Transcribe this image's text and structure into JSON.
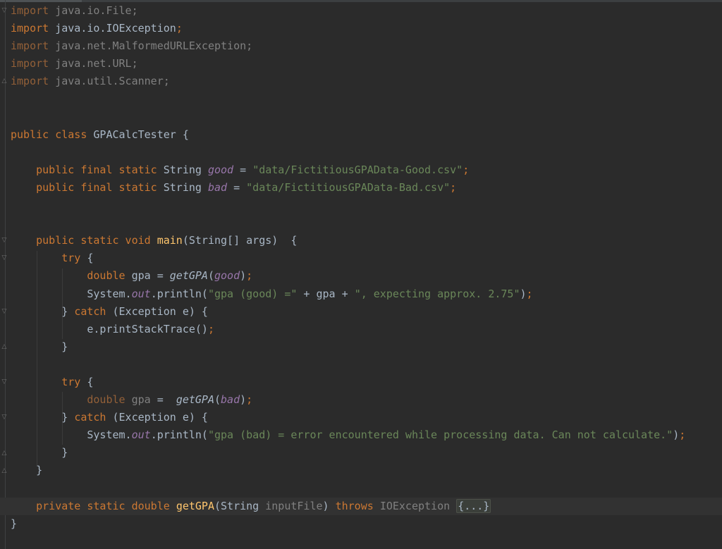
{
  "lines": [
    {
      "segs": [
        [
          "kw dim-kw",
          "import"
        ],
        [
          "dim",
          " java.io.File;"
        ]
      ]
    },
    {
      "segs": [
        [
          "kw",
          "import"
        ],
        [
          "",
          " java.io.IOException"
        ],
        [
          "kw",
          ";"
        ]
      ]
    },
    {
      "segs": [
        [
          "kw dim-kw",
          "import"
        ],
        [
          "dim",
          " java.net.MalformedURLException;"
        ]
      ]
    },
    {
      "segs": [
        [
          "kw dim-kw",
          "import"
        ],
        [
          "dim",
          " java.net.URL;"
        ]
      ]
    },
    {
      "segs": [
        [
          "kw dim-kw",
          "import"
        ],
        [
          "dim",
          " java.util.Scanner;"
        ]
      ]
    },
    {
      "segs": []
    },
    {
      "segs": []
    },
    {
      "segs": [
        [
          "kw",
          "public class "
        ],
        [
          "",
          "GPACalcTester {"
        ]
      ]
    },
    {
      "segs": []
    },
    {
      "segs": [
        [
          "",
          "    "
        ],
        [
          "kw",
          "public final static "
        ],
        [
          "",
          "String "
        ],
        [
          "fld",
          "good"
        ],
        [
          "",
          " = "
        ],
        [
          "str",
          "\"data/FictitiousGPAData-Good.csv\""
        ],
        [
          "kw",
          ";"
        ]
      ]
    },
    {
      "segs": [
        [
          "",
          "    "
        ],
        [
          "kw",
          "public final static "
        ],
        [
          "",
          "String "
        ],
        [
          "fld",
          "bad"
        ],
        [
          "",
          " = "
        ],
        [
          "str",
          "\"data/FictitiousGPAData-Bad.csv\""
        ],
        [
          "kw",
          ";"
        ]
      ]
    },
    {
      "segs": []
    },
    {
      "segs": []
    },
    {
      "segs": [
        [
          "",
          "    "
        ],
        [
          "kw",
          "public static void "
        ],
        [
          "meth",
          "main"
        ],
        [
          "",
          "(String[] args)  {"
        ]
      ]
    },
    {
      "segs": [
        [
          "",
          "        "
        ],
        [
          "kw",
          "try "
        ],
        [
          "",
          "{"
        ]
      ]
    },
    {
      "segs": [
        [
          "",
          "            "
        ],
        [
          "kw",
          "double "
        ],
        [
          "",
          "gpa = "
        ],
        [
          "itm",
          "getGPA"
        ],
        [
          "",
          "("
        ],
        [
          "fld",
          "good"
        ],
        [
          "",
          ")"
        ],
        [
          "kw",
          ";"
        ]
      ]
    },
    {
      "segs": [
        [
          "",
          "            System."
        ],
        [
          "fld",
          "out"
        ],
        [
          "",
          ".println("
        ],
        [
          "str",
          "\"gpa (good) =\""
        ],
        [
          "",
          " + gpa + "
        ],
        [
          "str",
          "\", expecting approx. 2.75\""
        ],
        [
          "",
          ")"
        ],
        [
          "kw",
          ";"
        ]
      ]
    },
    {
      "segs": [
        [
          "",
          "        } "
        ],
        [
          "kw",
          "catch "
        ],
        [
          "",
          "(Exception e) {"
        ]
      ]
    },
    {
      "segs": [
        [
          "",
          "            e.printStackTrace()"
        ],
        [
          "kw",
          ";"
        ]
      ]
    },
    {
      "segs": [
        [
          "",
          "        }"
        ]
      ]
    },
    {
      "segs": []
    },
    {
      "segs": [
        [
          "",
          "        "
        ],
        [
          "kw",
          "try "
        ],
        [
          "",
          "{"
        ]
      ]
    },
    {
      "segs": [
        [
          "",
          "            "
        ],
        [
          "kw dim-kw",
          "double "
        ],
        [
          "dim",
          "gpa"
        ],
        [
          "",
          " =  "
        ],
        [
          "itm",
          "getGPA"
        ],
        [
          "",
          "("
        ],
        [
          "fld",
          "bad"
        ],
        [
          "",
          ")"
        ],
        [
          "kw",
          ";"
        ]
      ]
    },
    {
      "segs": [
        [
          "",
          "        } "
        ],
        [
          "kw",
          "catch "
        ],
        [
          "",
          "(Exception e) {"
        ]
      ]
    },
    {
      "segs": [
        [
          "",
          "            System."
        ],
        [
          "fld",
          "out"
        ],
        [
          "",
          ".println("
        ],
        [
          "str",
          "\"gpa (bad) = error encountered while processing data. Can not calculate.\""
        ],
        [
          "",
          ")"
        ],
        [
          "kw",
          ";"
        ]
      ]
    },
    {
      "segs": [
        [
          "",
          "        }"
        ]
      ]
    },
    {
      "segs": [
        [
          "",
          "    }"
        ]
      ]
    },
    {
      "segs": []
    },
    {
      "current": true,
      "segs": [
        [
          "",
          "    "
        ],
        [
          "kw",
          "private static double "
        ],
        [
          "meth",
          "getGPA"
        ],
        [
          "",
          "(String "
        ],
        [
          "dim",
          "inputFile"
        ],
        [
          "",
          ") "
        ],
        [
          "kw",
          "throws "
        ],
        [
          "dim",
          "IOException "
        ],
        [
          "collapsed",
          "{...}"
        ]
      ]
    },
    {
      "segs": [
        [
          "",
          "}"
        ]
      ]
    }
  ],
  "gutter": {
    "folds_minus": [
      0,
      13,
      14,
      17,
      21,
      23
    ],
    "folds_end": [
      4,
      19,
      25,
      26
    ],
    "fold_plus": [
      28
    ],
    "bulb_icon": "lightbulb-icon",
    "bulb_color": "#e6b422"
  },
  "colors": {
    "background": "#2b2b2b",
    "keyword": "#cc7832",
    "string": "#6a8759",
    "field": "#9876aa",
    "method": "#ffc66d",
    "text": "#a9b7c6"
  }
}
